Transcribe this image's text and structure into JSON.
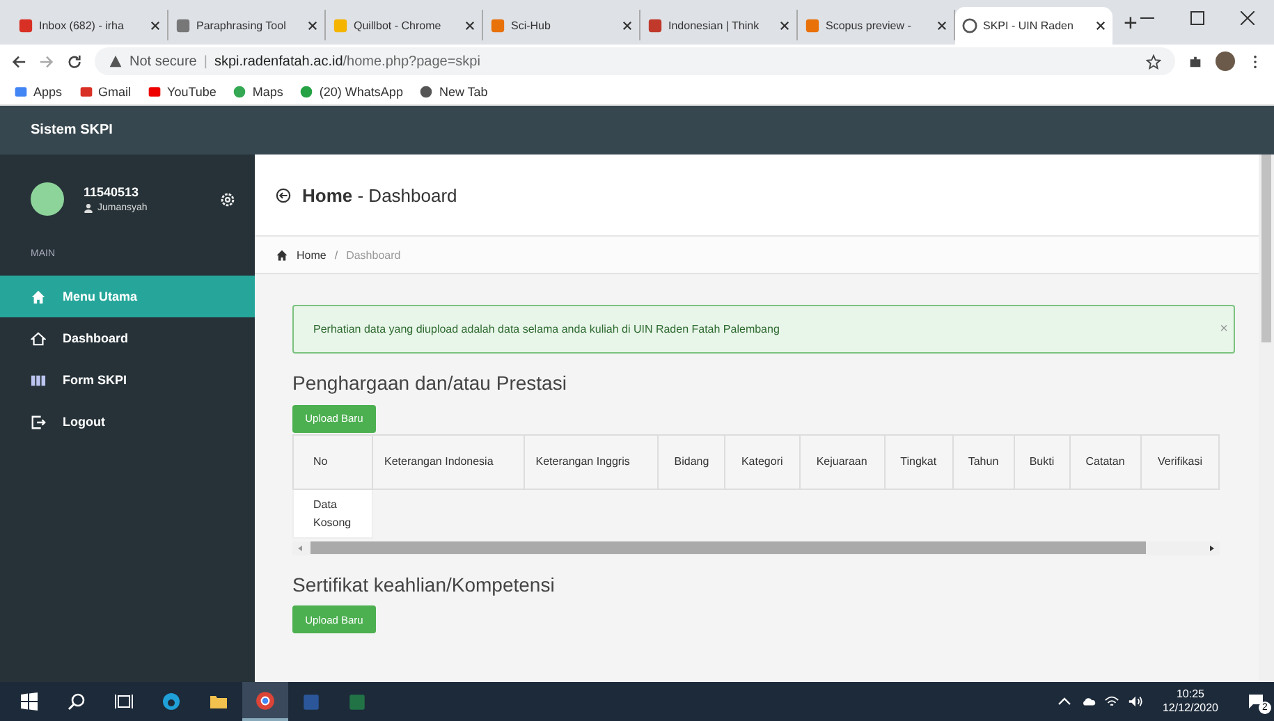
{
  "browser": {
    "tabs": [
      {
        "title": "Inbox (682) - irha",
        "selected": false
      },
      {
        "title": "Paraphrasing Tool",
        "selected": false
      },
      {
        "title": "Quillbot - Chrome",
        "selected": false
      },
      {
        "title": "Sci-Hub",
        "selected": false
      },
      {
        "title": "Indonesian | Think",
        "selected": false
      },
      {
        "title": "Scopus preview -",
        "selected": false
      },
      {
        "title": "SKPI - UIN Raden",
        "selected": true
      }
    ],
    "new_tab": "+",
    "security": "Not secure",
    "url_separator": "|",
    "url_host": "skpi.radenfatah.ac.id",
    "url_path": "/home.php?page=skpi",
    "bookmarks": [
      "Apps",
      "Gmail",
      "YouTube",
      "Maps",
      "(20) WhatsApp",
      "New Tab"
    ]
  },
  "app": {
    "title": "Sistem SKPI",
    "user_id": "11540513",
    "user_name": "Jumansyah",
    "section": "MAIN",
    "menu": [
      {
        "label": "Menu Utama",
        "selected": true
      },
      {
        "label": "Dashboard",
        "selected": false
      },
      {
        "label": "Form SKPI",
        "selected": false
      },
      {
        "label": "Logout",
        "selected": false
      }
    ],
    "page_title": "Home",
    "page_subtitle": "- Dashboard",
    "breadcrumb": [
      "Home",
      "Dashboard"
    ],
    "breadcrumb_separator": "/",
    "alert": "Perhatian data yang diupload adalah data selama anda kuliah di UIN Raden Fatah Palembang",
    "alert_close": "×",
    "sections": [
      {
        "title": "Penghargaan dan/atau Prestasi",
        "button": "Upload Baru",
        "columns": [
          "No",
          "Keterangan Indonesia",
          "Keterangan Inggris",
          "Bidang",
          "Kategori",
          "Kejuaraan",
          "Tingkat",
          "Tahun",
          "Bukti",
          "Catatan",
          "Verifikasi"
        ],
        "empty_text": "Data Kosong"
      },
      {
        "title": "Sertifikat keahlian/Kompetensi",
        "button": "Upload Baru"
      }
    ]
  },
  "taskbar": {
    "time": "10:25",
    "date": "12/12/2020",
    "notifications": "2",
    "apps": [
      {
        "selected": true
      },
      {
        "selected": false
      },
      {
        "selected": false
      }
    ]
  }
}
